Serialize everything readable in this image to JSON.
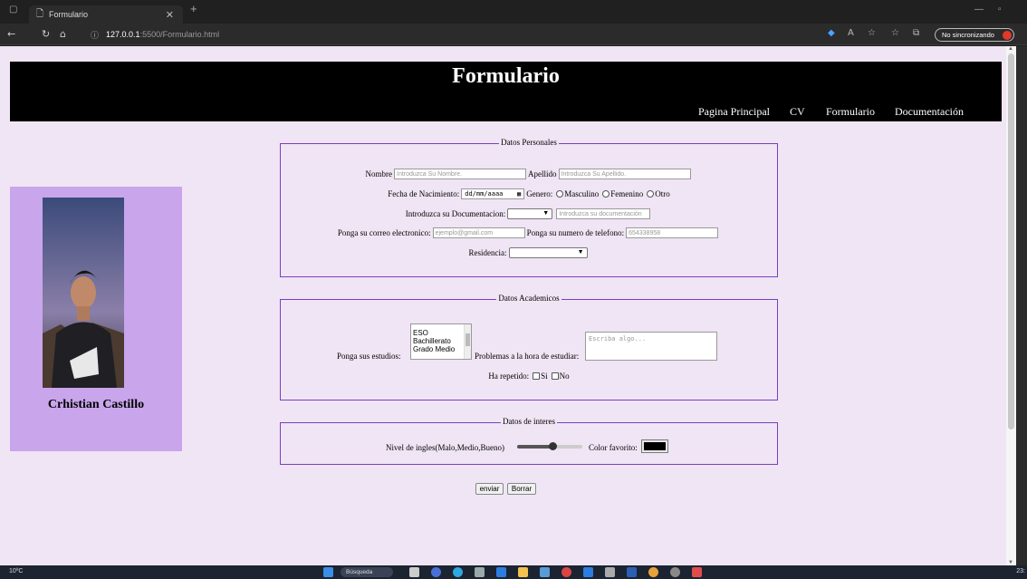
{
  "browser": {
    "tab_title": "Formulario",
    "url_host": "127.0.0.1",
    "url_path": ":5500/Formulario.html",
    "sync_label": "No sincronizando"
  },
  "header": {
    "title": "Formulario",
    "nav": [
      "Pagina Principal",
      "CV",
      "Formulario",
      "Documentación"
    ]
  },
  "profile": {
    "name": "Crhistian Castillo"
  },
  "personal": {
    "legend": "Datos Personales",
    "nombre_label": "Nombre",
    "nombre_placeholder": "Introduzca Su Nombre.",
    "apellido_label": "Apellido",
    "apellido_placeholder": "Introduzca Su Apellido.",
    "fecha_label": "Fecha de Nacimiento:",
    "fecha_placeholder": "dd/mm/aaaa",
    "genero_label": "Genero:",
    "genero_options": [
      "Masculino",
      "Femenino",
      "Otro"
    ],
    "doc_label": "Introduzca su Documentacion:",
    "doc_placeholder": "Introduzca su documentación",
    "correo_label": "Ponga su correo electronico:",
    "correo_placeholder": "ejemplo@gmail.com",
    "telefono_label": "Ponga su numero de telefono:",
    "telefono_placeholder": "654338958",
    "residencia_label": "Residencia:"
  },
  "academic": {
    "legend": "Datos Academicos",
    "estudios_label": "Ponga sus estudios:",
    "estudios_options": [
      "ESO",
      "Bachillerato",
      "Grado Medio"
    ],
    "problemas_label": "Problemas a la hora de estudiar:",
    "problemas_placeholder": "Escriba algo...",
    "repetido_label": "Ha repetido:",
    "repetido_options": [
      "Si",
      "No"
    ]
  },
  "interests": {
    "legend": "Datos de interes",
    "ingles_label": "Nivel de ingles(Malo,Medio,Bueno)",
    "ingles_level": 0.55,
    "color_label": "Color favorito:",
    "color_value": "#000000"
  },
  "buttons": {
    "enviar": "enviar",
    "borrar": "Borrar"
  },
  "taskbar": {
    "weather": "10ºC",
    "search": "Búsqueda",
    "clock": "23:"
  },
  "colors": {
    "page_bg": "#f0e5f4",
    "header_bg": "#000000",
    "profile_bg": "#c9a5ec",
    "fieldset_border": "#7a3fc0"
  }
}
